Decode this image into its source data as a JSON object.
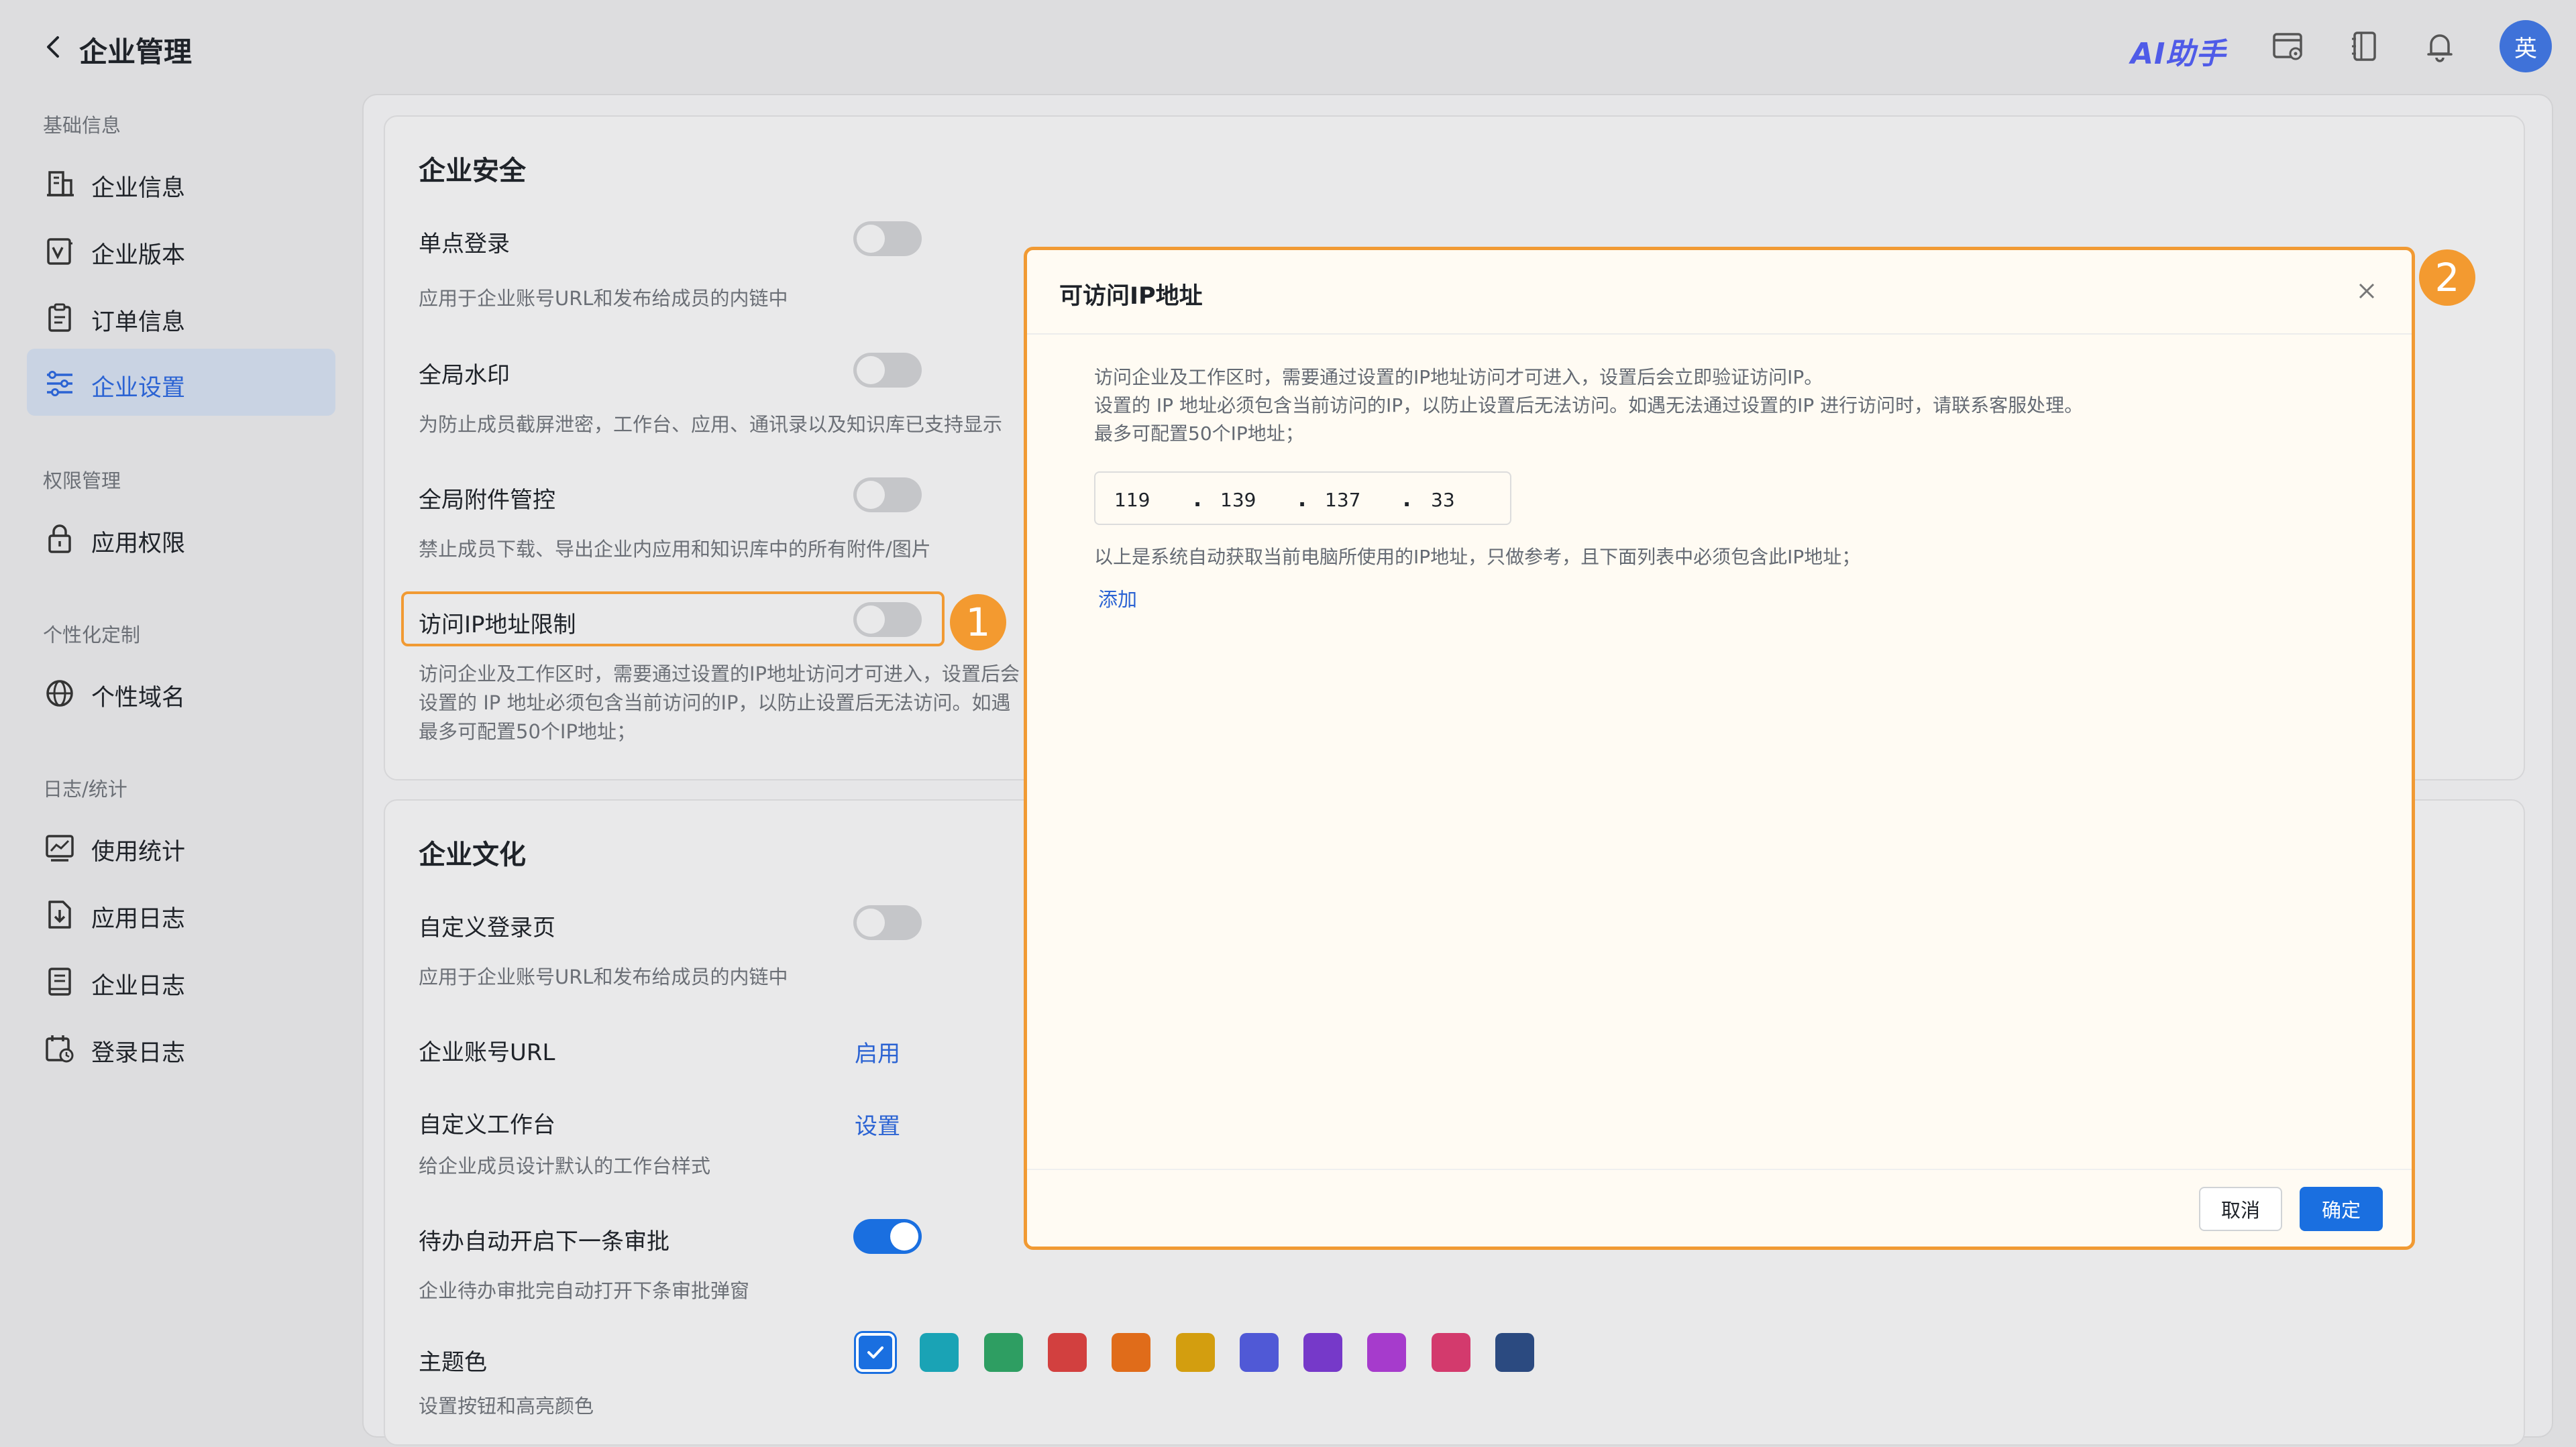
{
  "header": {
    "title": "企业管理",
    "ai_label": "AI助手",
    "avatar_text": "英"
  },
  "sidebar": {
    "sections": [
      {
        "title": "基础信息",
        "items": [
          {
            "label": "企业信息",
            "icon": "building-icon"
          },
          {
            "label": "企业版本",
            "icon": "version-icon"
          },
          {
            "label": "订单信息",
            "icon": "clipboard-icon"
          },
          {
            "label": "企业设置",
            "icon": "settings-sliders-icon",
            "active": true
          }
        ]
      },
      {
        "title": "权限管理",
        "items": [
          {
            "label": "应用权限",
            "icon": "lock-icon"
          }
        ]
      },
      {
        "title": "个性化定制",
        "items": [
          {
            "label": "个性域名",
            "icon": "globe-icon"
          }
        ]
      },
      {
        "title": "日志/统计",
        "items": [
          {
            "label": "使用统计",
            "icon": "chart-icon"
          },
          {
            "label": "应用日志",
            "icon": "download-doc-icon"
          },
          {
            "label": "企业日志",
            "icon": "book-icon"
          },
          {
            "label": "登录日志",
            "icon": "calendar-clock-icon"
          }
        ]
      }
    ]
  },
  "security": {
    "title": "企业安全",
    "rows": [
      {
        "label": "单点登录",
        "desc": "应用于企业账号URL和发布给成员的内链中",
        "on": false
      },
      {
        "label": "全局水印",
        "desc": "为防止成员截屏泄密，工作台、应用、通讯录以及知识库已支持显示",
        "on": false
      },
      {
        "label": "全局附件管控",
        "desc": "禁止成员下载、导出企业内应用和知识库中的所有附件/图片",
        "on": false
      },
      {
        "label": "访问IP地址限制",
        "on": false,
        "desc_lines": [
          "访问企业及工作区时，需要通过设置的IP地址访问才可进入，设置后会",
          "设置的 IP 地址必须包含当前访问的IP，以防止设置后无法访问。如遇",
          "最多可配置50个IP地址；"
        ]
      }
    ]
  },
  "culture": {
    "title": "企业文化",
    "custom_login": {
      "label": "自定义登录页",
      "desc": "应用于企业账号URL和发布给成员的内链中",
      "on": false
    },
    "account_url": {
      "label": "企业账号URL",
      "action": "启用"
    },
    "workbench": {
      "label": "自定义工作台",
      "action": "设置",
      "desc": "给企业成员设计默认的工作台样式"
    },
    "auto_next": {
      "label": "待办自动开启下一条审批",
      "desc": "企业待办审批完自动打开下条审批弹窗",
      "on": true
    },
    "theme": {
      "label": "主题色",
      "desc": "设置按钮和高亮颜色",
      "colors": [
        "#1a6fe0",
        "#1aa3b5",
        "#2e9e62",
        "#d2403f",
        "#e06c1a",
        "#d39e0f",
        "#5059d6",
        "#7639c9",
        "#a63bcc",
        "#d33a6d",
        "#2b4a80"
      ],
      "selected_index": 0
    }
  },
  "annotations": {
    "badge1": "1",
    "badge2": "2"
  },
  "modal": {
    "title": "可访问IP地址",
    "desc_lines": [
      "访问企业及工作区时，需要通过设置的IP地址访问才可进入，设置后会立即验证访问IP。",
      "设置的 IP 地址必须包含当前访问的IP，以防止设置后无法访问。如遇无法通过设置的IP 进行访问时，请联系客服处理。",
      "最多可配置50个IP地址；"
    ],
    "ip_segments": [
      "119",
      "139",
      "137",
      "33"
    ],
    "ip_dot": ".",
    "hint": "以上是系统自动获取当前电脑所使用的IP地址，只做参考，且下面列表中必须包含此IP地址；",
    "add_label": "添加",
    "cancel_label": "取消",
    "ok_label": "确定"
  }
}
